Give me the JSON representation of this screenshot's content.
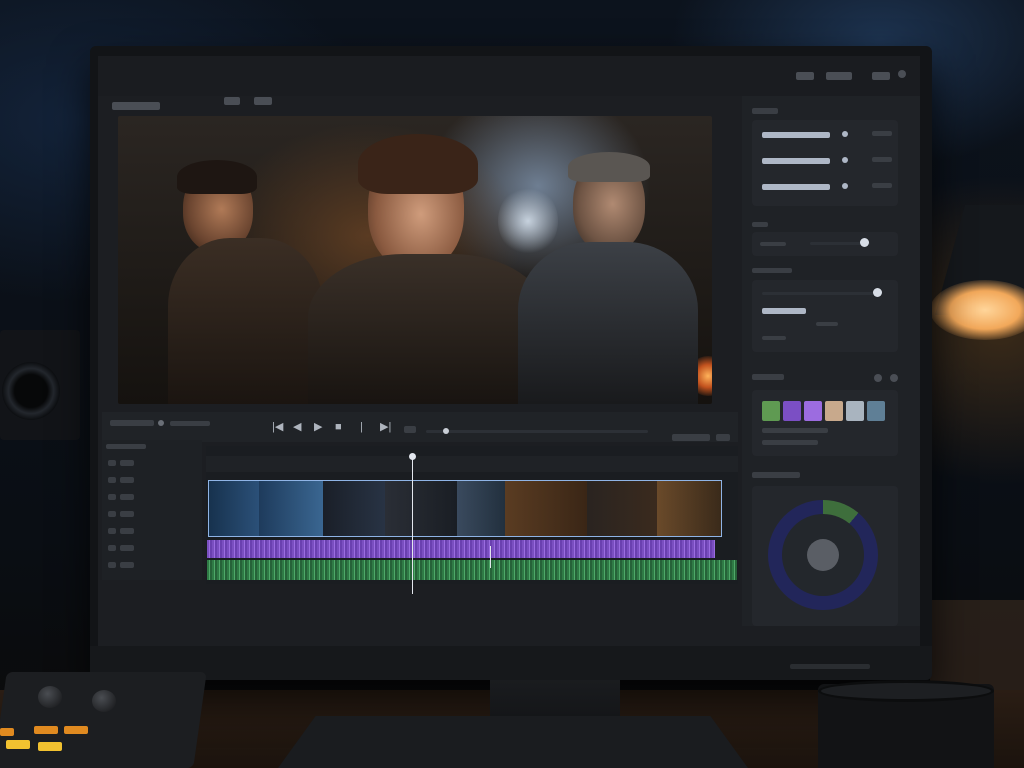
{
  "app": {
    "title": ""
  },
  "preview": {
    "scene": ""
  },
  "transport": {
    "buttons": [
      "|◀",
      "◀",
      "▶",
      "■",
      "|",
      "▶|"
    ]
  },
  "timeline": {
    "tracks": 7
  },
  "sidebar": {
    "color_swatches": [
      "#5f9a52",
      "#7b4fc4",
      "#9c6ce0",
      "#c8a98c",
      "#a9b4bf",
      "#5f7f96"
    ]
  },
  "colors": {
    "accent_blue": "#8fb4e6",
    "audio_purple": "#8a5cd0",
    "audio_green": "#3f9256",
    "scope_green": "#3e6e3c"
  },
  "icons": [
    "skip-back-icon",
    "step-back-icon",
    "play-icon",
    "stop-icon",
    "mark-icon",
    "skip-forward-icon"
  ]
}
